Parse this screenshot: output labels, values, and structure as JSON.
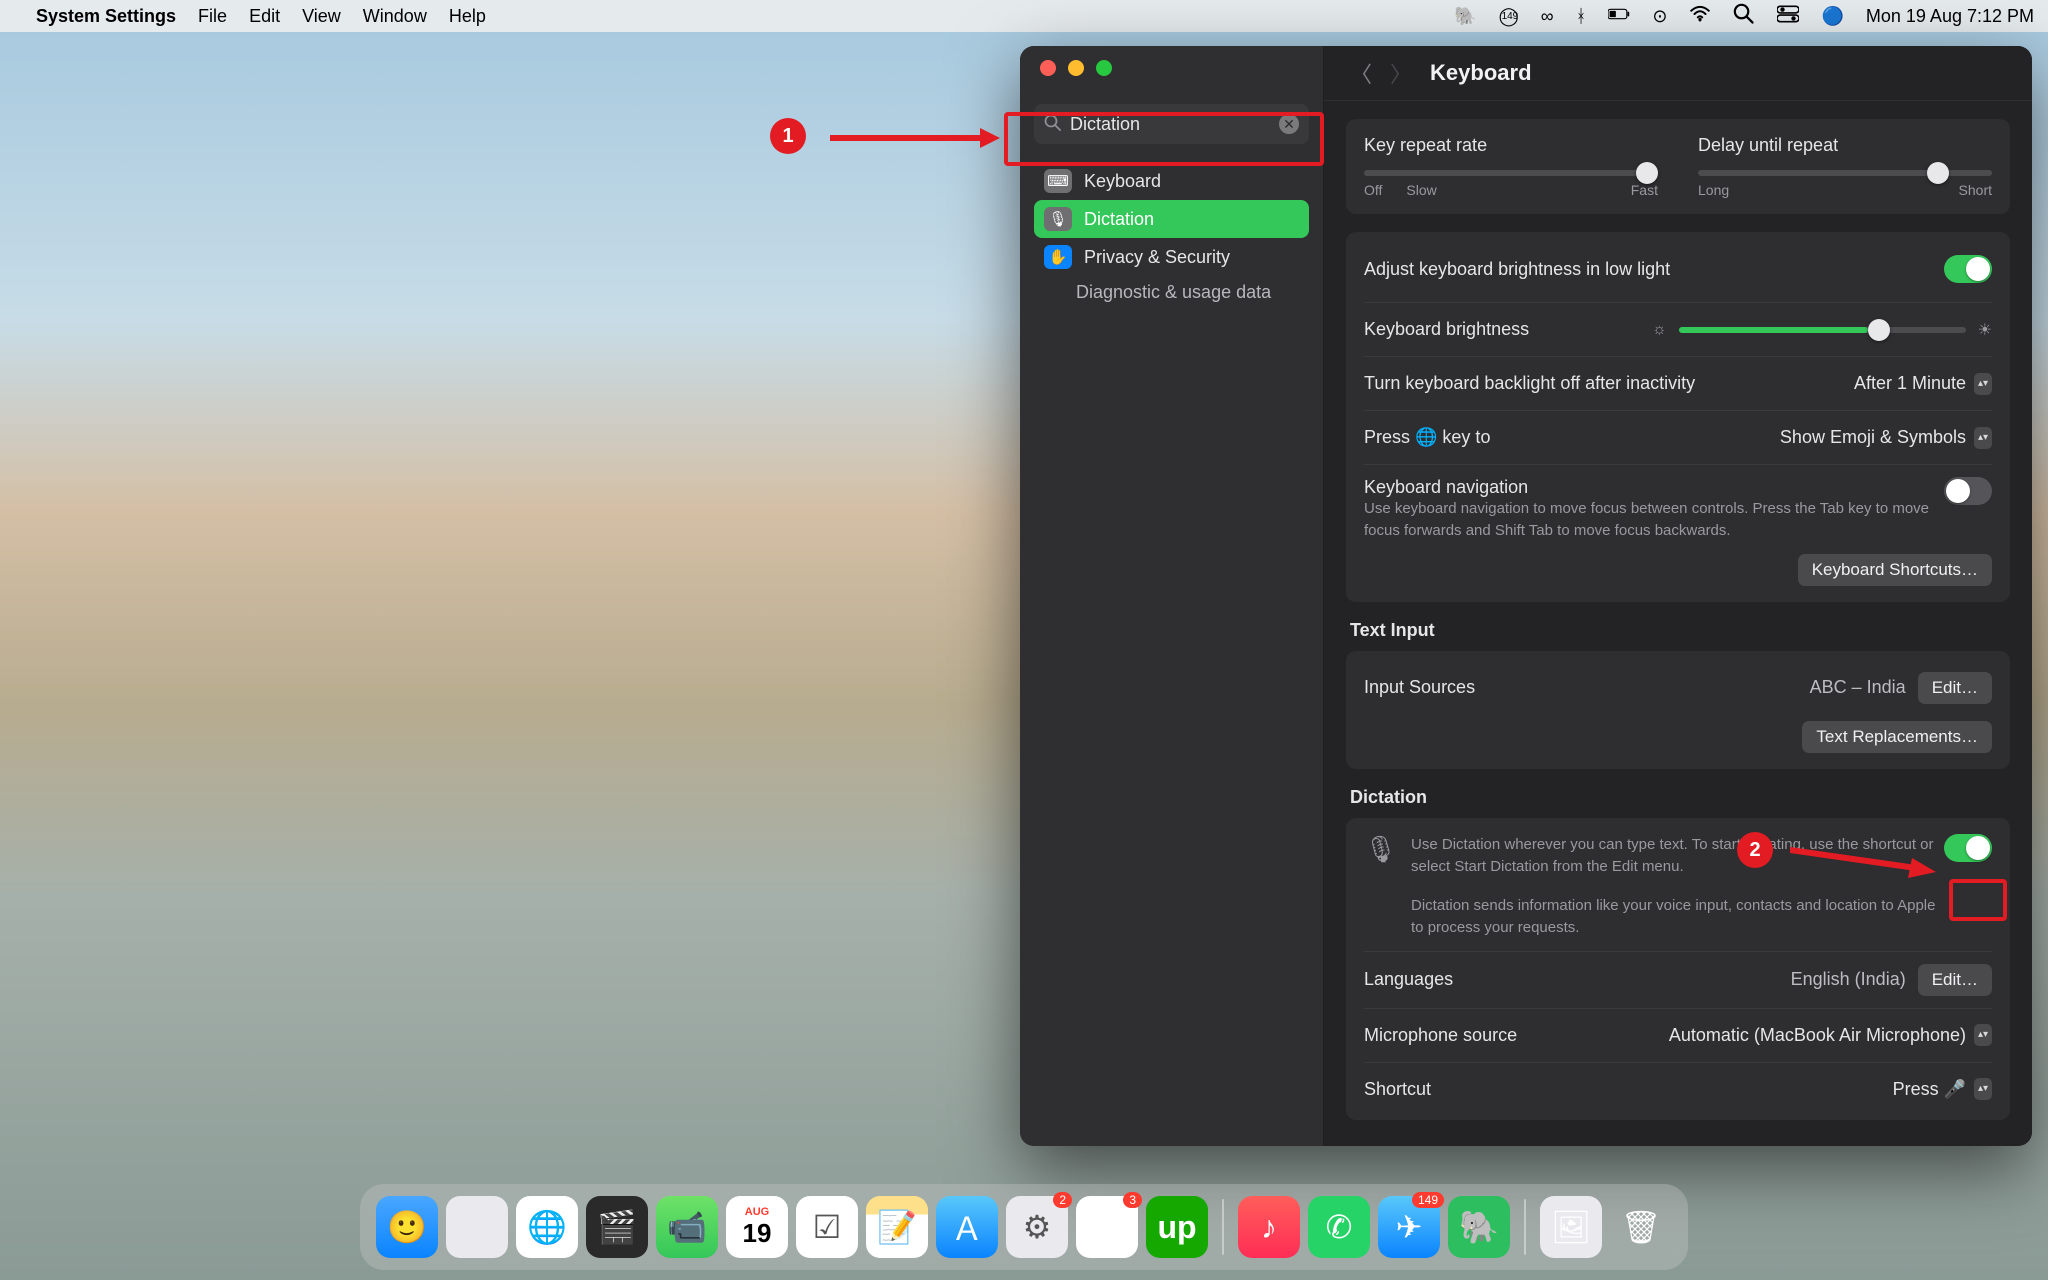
{
  "menubar": {
    "app_name": "System Settings",
    "menus": [
      "File",
      "Edit",
      "View",
      "Window",
      "Help"
    ],
    "status_badge": "149",
    "clock": "Mon 19 Aug  7:12 PM"
  },
  "sidebar": {
    "search_value": "Dictation",
    "items": [
      {
        "label": "Keyboard",
        "icon": "keyboard-icon",
        "active": false
      },
      {
        "label": "Dictation",
        "icon": "mic-icon",
        "active": true
      },
      {
        "label": "Privacy & Security",
        "icon": "hand-icon",
        "active": false
      }
    ],
    "sub_item": "Diagnostic & usage data"
  },
  "panel": {
    "title": "Keyboard",
    "key_repeat_label": "Key repeat rate",
    "key_repeat_lo": "Off",
    "key_repeat_lo2": "Slow",
    "key_repeat_hi": "Fast",
    "delay_label": "Delay until repeat",
    "delay_lo": "Long",
    "delay_hi": "Short",
    "brightness_auto_label": "Adjust keyboard brightness in low light",
    "brightness_label": "Keyboard brightness",
    "backlight_off_label": "Turn keyboard backlight off after inactivity",
    "backlight_off_value": "After 1 Minute",
    "press_globe_label": "Press 🌐 key to",
    "press_globe_value": "Show Emoji & Symbols",
    "kb_nav_label": "Keyboard navigation",
    "kb_nav_desc": "Use keyboard navigation to move focus between controls. Press the Tab key to move focus forwards and Shift Tab to move focus backwards.",
    "kb_shortcuts_btn": "Keyboard Shortcuts…",
    "text_input_head": "Text Input",
    "input_sources_label": "Input Sources",
    "input_sources_value": "ABC – India",
    "edit_btn": "Edit…",
    "text_repl_btn": "Text Replacements…",
    "dictation_head": "Dictation",
    "dictation_desc": "Use Dictation wherever you can type text. To start dictating, use the shortcut or select Start Dictation from the Edit menu.",
    "dictation_privacy": "Dictation sends information like your voice input, contacts and location to Apple to process your requests.",
    "languages_label": "Languages",
    "languages_value": "English (India)",
    "mic_source_label": "Microphone source",
    "mic_source_value": "Automatic (MacBook Air Microphone)",
    "shortcut_label": "Shortcut",
    "shortcut_value": "Press 🎤"
  },
  "annotations": {
    "b1": "1",
    "b2": "2"
  },
  "dock": {
    "apps": [
      "finder",
      "launchpad",
      "chrome",
      "fcp",
      "facetime",
      "calendar",
      "reminders",
      "notes",
      "appstore",
      "settings",
      "slack",
      "upwork"
    ],
    "apps2": [
      "music",
      "whatsapp",
      "telegram",
      "evernote"
    ],
    "apps3": [
      "preview",
      "trash"
    ],
    "calendar_day": "19",
    "calendar_month": "AUG",
    "slack_badge": "3",
    "settings_badge": "2",
    "telegram_badge": "149"
  }
}
